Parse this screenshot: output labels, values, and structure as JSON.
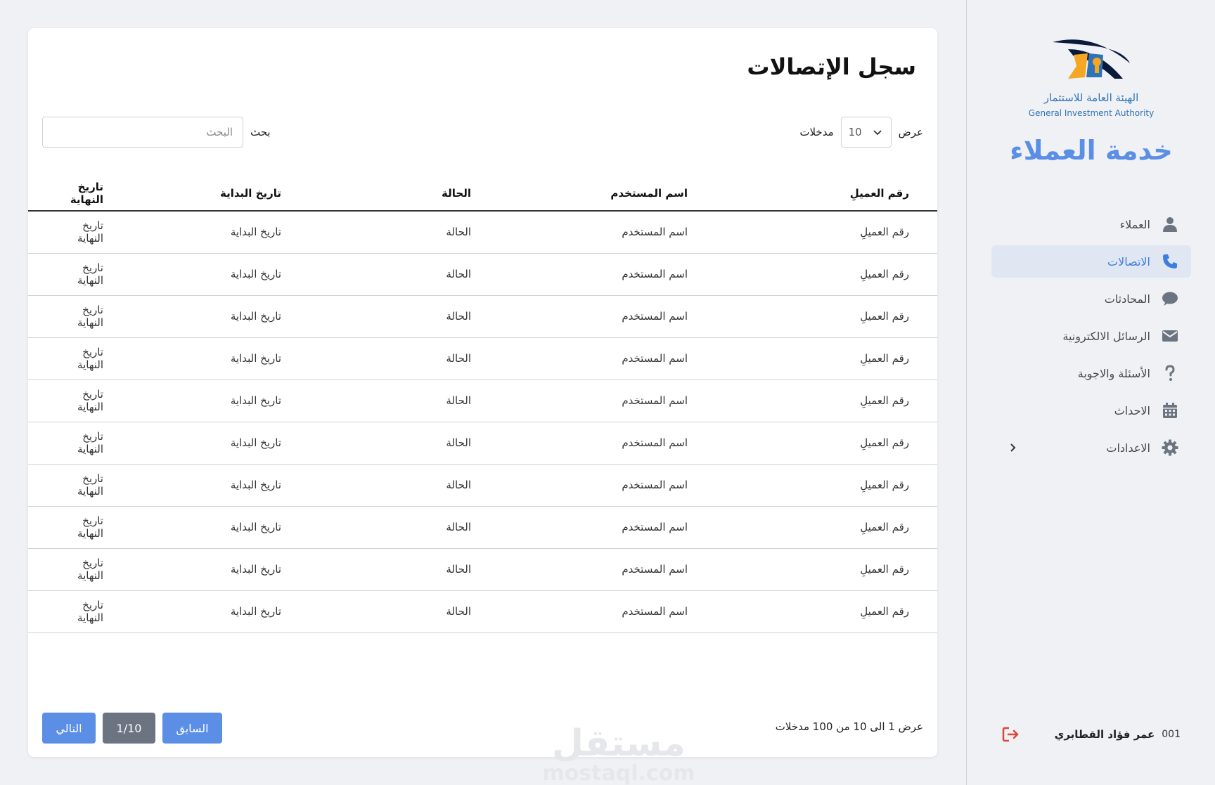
{
  "sidebar": {
    "logo": {
      "arabic_text": "الهيئة العامة للاستثمار",
      "english_text": "General Investment Authority"
    },
    "brand_title": "خدمة العملاء",
    "items": [
      {
        "label": "العملاء",
        "icon": "user-icon",
        "active": false
      },
      {
        "label": "الاتصالات",
        "icon": "phone-icon",
        "active": true
      },
      {
        "label": "المحادثات",
        "icon": "chat-icon",
        "active": false
      },
      {
        "label": "الرسائل الالكترونية",
        "icon": "envelope-icon",
        "active": false
      },
      {
        "label": "الأسئلة والاجوبة",
        "icon": "question-icon",
        "active": false
      },
      {
        "label": "الاحداث",
        "icon": "calendar-icon",
        "active": false
      },
      {
        "label": "الاعدادات",
        "icon": "gear-icon",
        "active": false
      }
    ],
    "user": {
      "id": "001",
      "name": "عمر فؤاد القطابري"
    },
    "colors": {
      "accent": "#5b8fe6",
      "active_bg": "#e1e7f2",
      "logout": "#e0453a"
    }
  },
  "main": {
    "title": "سجل الإتصالات",
    "length": {
      "prefix": "عرض",
      "value": "10",
      "suffix": "مدخلات"
    },
    "search": {
      "label": "بحث",
      "placeholder": "البحث",
      "value": ""
    },
    "table": {
      "headers": [
        "رقم العميلِ",
        "اسم المستخدم",
        "الحالة",
        "تاريخ البداية",
        "تاريخ النهاية"
      ],
      "rows": [
        [
          "رقم العميلِ",
          "اسم المستخدم",
          "الحالة",
          "تاريخ البداية",
          "تاريخ النهاية"
        ],
        [
          "رقم العميلِ",
          "اسم المستخدم",
          "الحالة",
          "تاريخ البداية",
          "تاريخ النهاية"
        ],
        [
          "رقم العميلِ",
          "اسم المستخدم",
          "الحالة",
          "تاريخ البداية",
          "تاريخ النهاية"
        ],
        [
          "رقم العميلِ",
          "اسم المستخدم",
          "الحالة",
          "تاريخ البداية",
          "تاريخ النهاية"
        ],
        [
          "رقم العميلِ",
          "اسم المستخدم",
          "الحالة",
          "تاريخ البداية",
          "تاريخ النهاية"
        ],
        [
          "رقم العميلِ",
          "اسم المستخدم",
          "الحالة",
          "تاريخ البداية",
          "تاريخ النهاية"
        ],
        [
          "رقم العميلِ",
          "اسم المستخدم",
          "الحالة",
          "تاريخ البداية",
          "تاريخ النهاية"
        ],
        [
          "رقم العميلِ",
          "اسم المستخدم",
          "الحالة",
          "تاريخ البداية",
          "تاريخ النهاية"
        ],
        [
          "رقم العميلِ",
          "اسم المستخدم",
          "الحالة",
          "تاريخ البداية",
          "تاريخ النهاية"
        ],
        [
          "رقم العميلِ",
          "اسم المستخدم",
          "الحالة",
          "تاريخ البداية",
          "تاريخ النهاية"
        ]
      ]
    },
    "footer": {
      "info": "عرض 1 الى 10 من 100 مدخلات",
      "prev_label": "السابق",
      "page_label": "1/10",
      "next_label": "التالي"
    }
  },
  "watermark": {
    "arabic": "مستقل",
    "latin": "mostaql.com"
  }
}
